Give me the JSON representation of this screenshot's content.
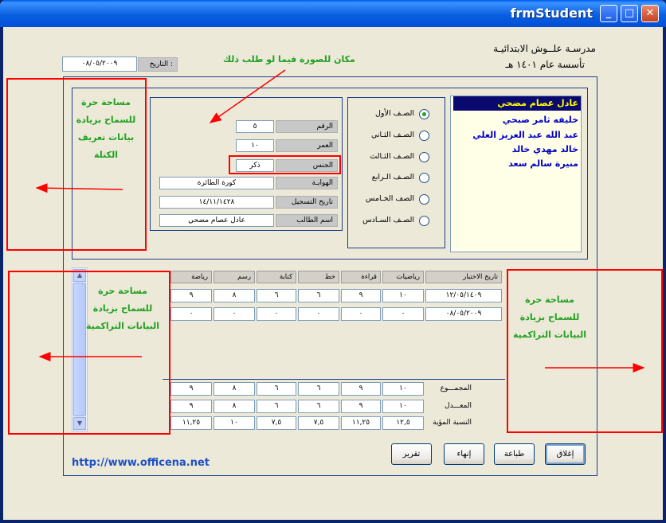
{
  "window": {
    "title": "frmStudent",
    "minimize_glyph": "_",
    "maximize_glyph": "□",
    "close_glyph": "✕"
  },
  "school": {
    "name": "مدرسـة علــوش الابتدائيـة",
    "founded": "تأسسة عام ١٤٠١ هـ"
  },
  "date": {
    "label": "التاريخ :",
    "value": "٠٨/٠٥/٢٠٠٩"
  },
  "annotations": {
    "photo_note": "مكان للصورة فيما لو طلب ذلك",
    "free_space_block": "مساحة حرة للسماح بزيادة بيانات تعريف الكتلة",
    "free_space_cum_left": "مساحة حرة للسماح بزيادة البيانات التراكمية",
    "free_space_cum_right": "مساحة حرة للسماح بزيادة البيانات التراكمية"
  },
  "student_list": [
    {
      "name": "عادل عصام مضحي",
      "selected": true
    },
    {
      "name": "خليفه ثامر صبحي",
      "selected": false
    },
    {
      "name": "عبد الله عبد العزيز العلي",
      "selected": false
    },
    {
      "name": "خالد مهدي خالد",
      "selected": false
    },
    {
      "name": "منيرة سالم سعد",
      "selected": false
    }
  ],
  "grades": [
    {
      "label": "الصـف الأول",
      "checked": true
    },
    {
      "label": "الصـف الثـاني",
      "checked": false
    },
    {
      "label": "الصـف الثـالث",
      "checked": false
    },
    {
      "label": "الصـف الـرابع",
      "checked": false
    },
    {
      "label": "الصف الخـامس",
      "checked": false
    },
    {
      "label": "الصـف السـادس",
      "checked": false
    }
  ],
  "student": {
    "number_label": "الرقم",
    "number": "٥",
    "age_label": "العمر",
    "age": "١٠",
    "gender_label": "الجنس",
    "gender": "ذكر",
    "hobby_label": "الهوايـة",
    "hobby": "كورة الطائرة",
    "reg_date_label": "تاريخ التسجيل",
    "reg_date": "١٤/١١/١٤٢٨",
    "name_label": "اسم الطالب",
    "name": "عادل عصام مضحي"
  },
  "scores": {
    "headers": [
      "تاريخ الاختبار",
      "رياضيات",
      "قراءة",
      "خط",
      "كتابة",
      "رسم",
      "رياضة"
    ],
    "rows": [
      [
        "١٢/٠٥/١٤٠٩",
        "١٠",
        "٩",
        "٦",
        "٦",
        "٨",
        "٩"
      ],
      [
        "٠٨/٠٥/٢٠٠٩",
        "٠",
        "٠",
        "٠",
        "٠",
        "٠",
        "٠"
      ]
    ],
    "totals": [
      {
        "label": "المجمـــوع",
        "values": [
          "١٠",
          "٩",
          "٦",
          "٦",
          "٨",
          "٩"
        ]
      },
      {
        "label": "المعـــدل",
        "values": [
          "١٠",
          "٩",
          "٦",
          "٦",
          "٨",
          "٩"
        ]
      },
      {
        "label": "النسبة المؤية",
        "values": [
          "١٢,٥",
          "١١,٢٥",
          "٧,٥",
          "٧,٥",
          "١٠",
          "١١,٢٥"
        ]
      }
    ]
  },
  "buttons": {
    "close": "إغلاق",
    "print": "طباعة",
    "end": "إنهاء",
    "report": "تقرير"
  },
  "website": "http://www.officena.net",
  "colors": {
    "titlebar": "#0A5FE0",
    "annotation_green": "#1FA01F",
    "annotation_red": "#FF0000",
    "list_blue": "#0000C8",
    "selected_bg": "#0A0A6E",
    "selected_fg": "#FFFF00"
  }
}
